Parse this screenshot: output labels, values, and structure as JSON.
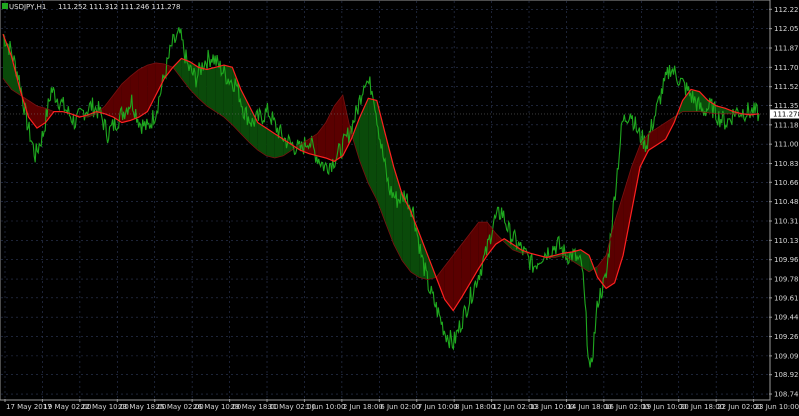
{
  "window": {
    "symbol": "USDJPY,H1",
    "ohlc": "111.252 111.312 111.246 111.278",
    "current_price": "111.278"
  },
  "colors": {
    "background": "#000000",
    "price_line": "#1fa81f",
    "ma_fast": "#ff2020",
    "cloud_bear": "#5a0000",
    "cloud_bull": "#0a4a0a",
    "grid": "#2f3a5a",
    "axis": "#9a9a9a"
  },
  "chart_data": {
    "type": "line",
    "title": "",
    "ylim": [
      108.7,
      112.3
    ],
    "y_ticks": [
      "112.225",
      "112.050",
      "111.875",
      "111.700",
      "111.525",
      "111.355",
      "111.180",
      "111.005",
      "110.830",
      "110.660",
      "110.485",
      "110.310",
      "110.135",
      "109.960",
      "109.785",
      "109.615",
      "109.440",
      "109.265",
      "109.090",
      "108.920",
      "108.745"
    ],
    "x_ticks": [
      "17 May 2017",
      "19 May 02:00",
      "22 May 10:00",
      "23 May 18:00",
      "25 May 02:00",
      "26 May 10:00",
      "29 May 18:00",
      "31 May 02:00",
      "1 Jun 10:00",
      "2 Jun 18:00",
      "6 Jun 02:00",
      "7 Jun 10:00",
      "8 Jun 18:00",
      "12 Jun 02:00",
      "13 Jun 10:00",
      "14 Jun 18:00",
      "16 Jun 02:00",
      "19 Jun 10:00",
      "20 Jun 18:00",
      "22 Jun 02:00",
      "23 Jun 10:00"
    ],
    "series": [
      {
        "role": "price",
        "values": [
          112.0,
          111.85,
          111.6,
          111.2,
          110.9,
          111.1,
          111.5,
          111.4,
          111.3,
          111.2,
          111.3,
          111.35,
          111.3,
          111.1,
          111.2,
          111.3,
          111.4,
          111.2,
          111.15,
          111.3,
          111.6,
          111.9,
          112.0,
          111.7,
          111.6,
          111.75,
          111.8,
          111.7,
          111.6,
          111.55,
          111.3,
          111.2,
          111.25,
          111.3,
          111.15,
          111.05,
          111.0,
          110.95,
          111.05,
          110.9,
          110.8,
          110.85,
          110.95,
          111.1,
          111.3,
          111.6,
          111.5,
          111.0,
          110.6,
          110.5,
          110.55,
          110.4,
          110.0,
          109.7,
          109.5,
          109.3,
          109.2,
          109.4,
          109.6,
          109.8,
          110.0,
          110.3,
          110.4,
          110.2,
          110.1,
          110.0,
          109.9,
          110.0,
          110.05,
          110.1,
          110.0,
          110.0,
          109.9,
          108.9,
          109.6,
          109.8,
          110.5,
          111.2,
          111.3,
          111.1,
          111.0,
          111.25,
          111.5,
          111.7,
          111.6,
          111.5,
          111.4,
          111.3,
          111.35,
          111.25,
          111.2,
          111.3,
          111.3,
          111.3,
          111.28
        ]
      },
      {
        "role": "ma-fast",
        "values": [
          112.0,
          111.8,
          111.5,
          111.25,
          111.15,
          111.2,
          111.3,
          111.3,
          111.28,
          111.25,
          111.27,
          111.3,
          111.28,
          111.25,
          111.2,
          111.22,
          111.25,
          111.3,
          111.45,
          111.6,
          111.7,
          111.78,
          111.75,
          111.7,
          111.68,
          111.7,
          111.72,
          111.7,
          111.5,
          111.35,
          111.2,
          111.15,
          111.1,
          111.05,
          111.0,
          110.95,
          110.92,
          110.9,
          110.88,
          110.85,
          110.9,
          111.05,
          111.25,
          111.42,
          111.4,
          111.1,
          110.8,
          110.55,
          110.4,
          110.2,
          110.0,
          109.8,
          109.6,
          109.5,
          109.62,
          109.75,
          109.88,
          110.0,
          110.1,
          110.15,
          110.1,
          110.05,
          110.02,
          110.0,
          109.98,
          110.0,
          110.02,
          110.03,
          110.05,
          110.0,
          109.8,
          109.7,
          109.75,
          110.0,
          110.4,
          110.8,
          110.95,
          111.0,
          111.05,
          111.2,
          111.4,
          111.5,
          111.48,
          111.4,
          111.35,
          111.33,
          111.3,
          111.28,
          111.27,
          111.28
        ]
      },
      {
        "role": "ma-slow",
        "values": [
          111.6,
          111.5,
          111.45,
          111.4,
          111.35,
          111.33,
          111.3,
          111.3,
          111.28,
          111.26,
          111.25,
          111.28,
          111.35,
          111.45,
          111.55,
          111.62,
          111.68,
          111.72,
          111.74,
          111.73,
          111.7,
          111.6,
          111.5,
          111.42,
          111.35,
          111.3,
          111.25,
          111.18,
          111.1,
          111.02,
          110.95,
          110.9,
          110.88,
          110.9,
          110.95,
          111.0,
          111.05,
          111.1,
          111.2,
          111.35,
          111.45,
          111.1,
          110.85,
          110.65,
          110.5,
          110.3,
          110.1,
          109.95,
          109.85,
          109.8,
          109.78,
          109.8,
          109.9,
          110.0,
          110.1,
          110.2,
          110.3,
          110.3,
          110.2,
          110.12,
          110.05,
          110.02,
          110.02,
          110.0,
          109.98,
          109.98,
          110.0,
          109.95,
          109.9,
          109.85,
          109.9,
          110.0,
          110.3,
          110.55,
          110.8,
          111.0,
          111.1,
          111.15,
          111.2,
          111.25,
          111.3,
          111.3,
          111.3,
          111.29,
          111.28,
          111.28,
          111.28,
          111.28,
          111.28,
          111.28
        ]
      }
    ]
  }
}
